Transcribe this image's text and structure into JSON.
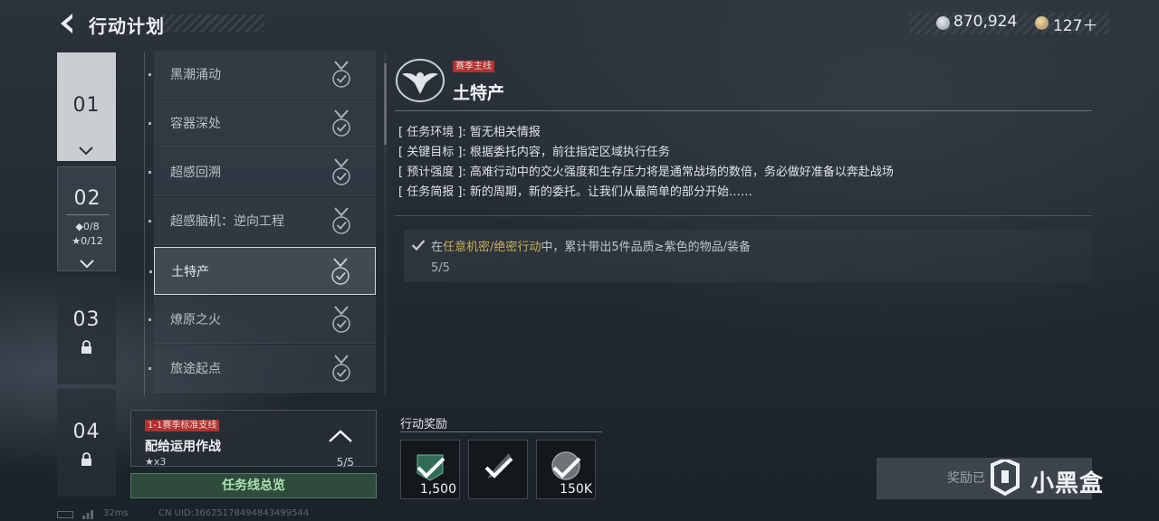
{
  "header": {
    "title": "行动计划",
    "currency_silver": "870,924",
    "currency_gold": "127＋"
  },
  "chapters": [
    {
      "label": "01"
    },
    {
      "label": "02",
      "diamonds": "◆0/8",
      "stars": "★0/12"
    },
    {
      "label": "03"
    },
    {
      "label": "04"
    }
  ],
  "missions": [
    {
      "name": "黑潮涌动"
    },
    {
      "name": "容器深处"
    },
    {
      "name": "超感回溯"
    },
    {
      "name": "超感脑机：逆向工程"
    },
    {
      "name": "土特产"
    },
    {
      "name": "燎原之火"
    },
    {
      "name": "旅途起点"
    }
  ],
  "branch": {
    "tag": "1-1赛季标准支线",
    "title": "配给运用作战",
    "stars": "★x3",
    "progress": "5/5"
  },
  "overview_button": "任务线总览",
  "status": {
    "ping": "32ms",
    "uid": "CN UID:36625178494843499544"
  },
  "detail": {
    "tag": "赛季主线",
    "title": "土特产",
    "info": [
      {
        "key": "[ 任务环境 ]",
        "value": ": 暂无相关情报"
      },
      {
        "key": "[ 关键目标 ]",
        "value": ": 根据委托内容，前往指定区域执行任务"
      },
      {
        "key": "[ 预计强度 ]",
        "value": ": 高难行动中的交火强度和生存压力将是通常战场的数倍，务必做好准备以奔赴战场"
      },
      {
        "key": "[ 任务简报 ]",
        "value": ": 新的周期，新的委托。让我们从最简单的部分开始……"
      }
    ],
    "objective": {
      "prefix": "在",
      "highlight": "任意机密/绝密行动",
      "suffix": "中，累计带出5件品质≥紫色的物品/装备",
      "progress": "5/5"
    }
  },
  "rewards": {
    "label": "行动奖励",
    "items": [
      {
        "icon": "emblem-icon",
        "amount": "1,500"
      },
      {
        "icon": "knife-icon",
        "amount": ""
      },
      {
        "icon": "coin-icon",
        "amount": "150K"
      }
    ],
    "claim_label": "奖励已"
  },
  "watermark": "小黑盒",
  "colors": {
    "tag_red": "#b0322e",
    "highlight": "#c8b05a",
    "overview_green": "#a9e0b0"
  }
}
